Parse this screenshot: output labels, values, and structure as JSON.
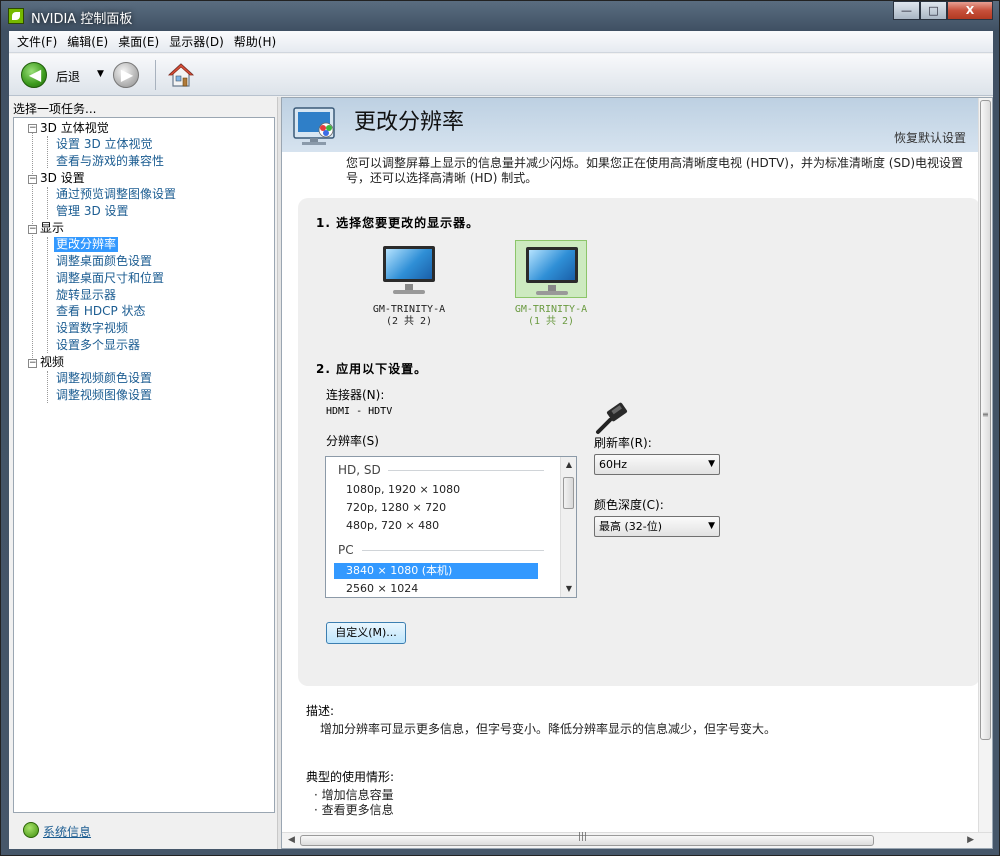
{
  "window": {
    "title": "NVIDIA 控制面板"
  },
  "window_buttons": {
    "minimize": "—",
    "maximize": "□",
    "close": "X"
  },
  "menu": [
    "文件(F)",
    "编辑(E)",
    "桌面(E)",
    "显示器(D)",
    "帮助(H)"
  ],
  "toolbar": {
    "back_label": "后退",
    "back_dropdown": "▼",
    "back_arrow": "◀",
    "forward_arrow": "▶"
  },
  "sidebar": {
    "header": "选择一项任务...",
    "tree": [
      {
        "label": "3D 立体视觉",
        "children": [
          "设置 3D 立体视觉",
          "查看与游戏的兼容性"
        ]
      },
      {
        "label": "3D 设置",
        "children": [
          "通过预览调整图像设置",
          "管理 3D 设置"
        ]
      },
      {
        "label": "显示",
        "children": [
          "更改分辨率",
          "调整桌面颜色设置",
          "调整桌面尺寸和位置",
          "旋转显示器",
          "查看 HDCP 状态",
          "设置数字视频",
          "设置多个显示器"
        ]
      },
      {
        "label": "视频",
        "children": [
          "调整视频颜色设置",
          "调整视频图像设置"
        ]
      }
    ],
    "selected": "更改分辨率",
    "toggle_symbol": "−",
    "system_info": "系统信息"
  },
  "page": {
    "title": "更改分辨率",
    "restore_defaults": "恢复默认设置",
    "intro_line1": "您可以调整屏幕上显示的信息量并减少闪烁。如果您正在使用高清晰度电视 (HDTV)，并为标准清晰度 (SD)电视设置",
    "intro_line2": "号，还可以选择高清晰 (HD) 制式。",
    "step1": "1. 选择您要更改的显示器。",
    "monitors": [
      {
        "name": "GM-TRINITY-A",
        "count": "(2 共 2)",
        "selected": false
      },
      {
        "name": "GM-TRINITY-A",
        "count": "(1 共 2)",
        "selected": true
      }
    ],
    "step2": "2. 应用以下设置。",
    "connector_label": "连接器(N):",
    "connector_value": "HDMI - HDTV",
    "resolution_label": "分辨率(S)",
    "resolution_groups": {
      "hd_sd": "HD, SD",
      "hd_sd_items": [
        "1080p, 1920 × 1080",
        "720p, 1280 × 720",
        "480p, 720 × 480"
      ],
      "pc": "PC",
      "pc_items": [
        "3840 × 1080 (本机)",
        "2560 × 1024"
      ],
      "selected": "3840 × 1080 (本机)"
    },
    "refresh_label": "刷新率(R):",
    "refresh_value": "60Hz",
    "color_depth_label": "颜色深度(C):",
    "color_depth_value": "最高 (32-位)",
    "custom_button": "自定义(M)...",
    "description_label": "描述:",
    "description_text": "增加分辨率可显示更多信息，但字号变小。降低分辨率显示的信息减少，但字号变大。",
    "usage_label": "典型的使用情形:",
    "usage_items": [
      "增加信息容量",
      "查看更多信息"
    ],
    "bullet": "·"
  },
  "scroll_glyphs": {
    "up": "▲",
    "down": "▼",
    "left": "◀",
    "right": "▶",
    "grip_v": "≡",
    "grip_h": "|||"
  },
  "icons": {
    "app": "nvidia-logo-icon",
    "home": "home-icon",
    "page": "display-settings-icon",
    "hdmi": "hdmi-connector-icon",
    "system_info": "system-info-icon"
  },
  "colors": {
    "selection": "#3399ff",
    "link": "#1b5c91",
    "nvidia_green": "#76b900"
  }
}
